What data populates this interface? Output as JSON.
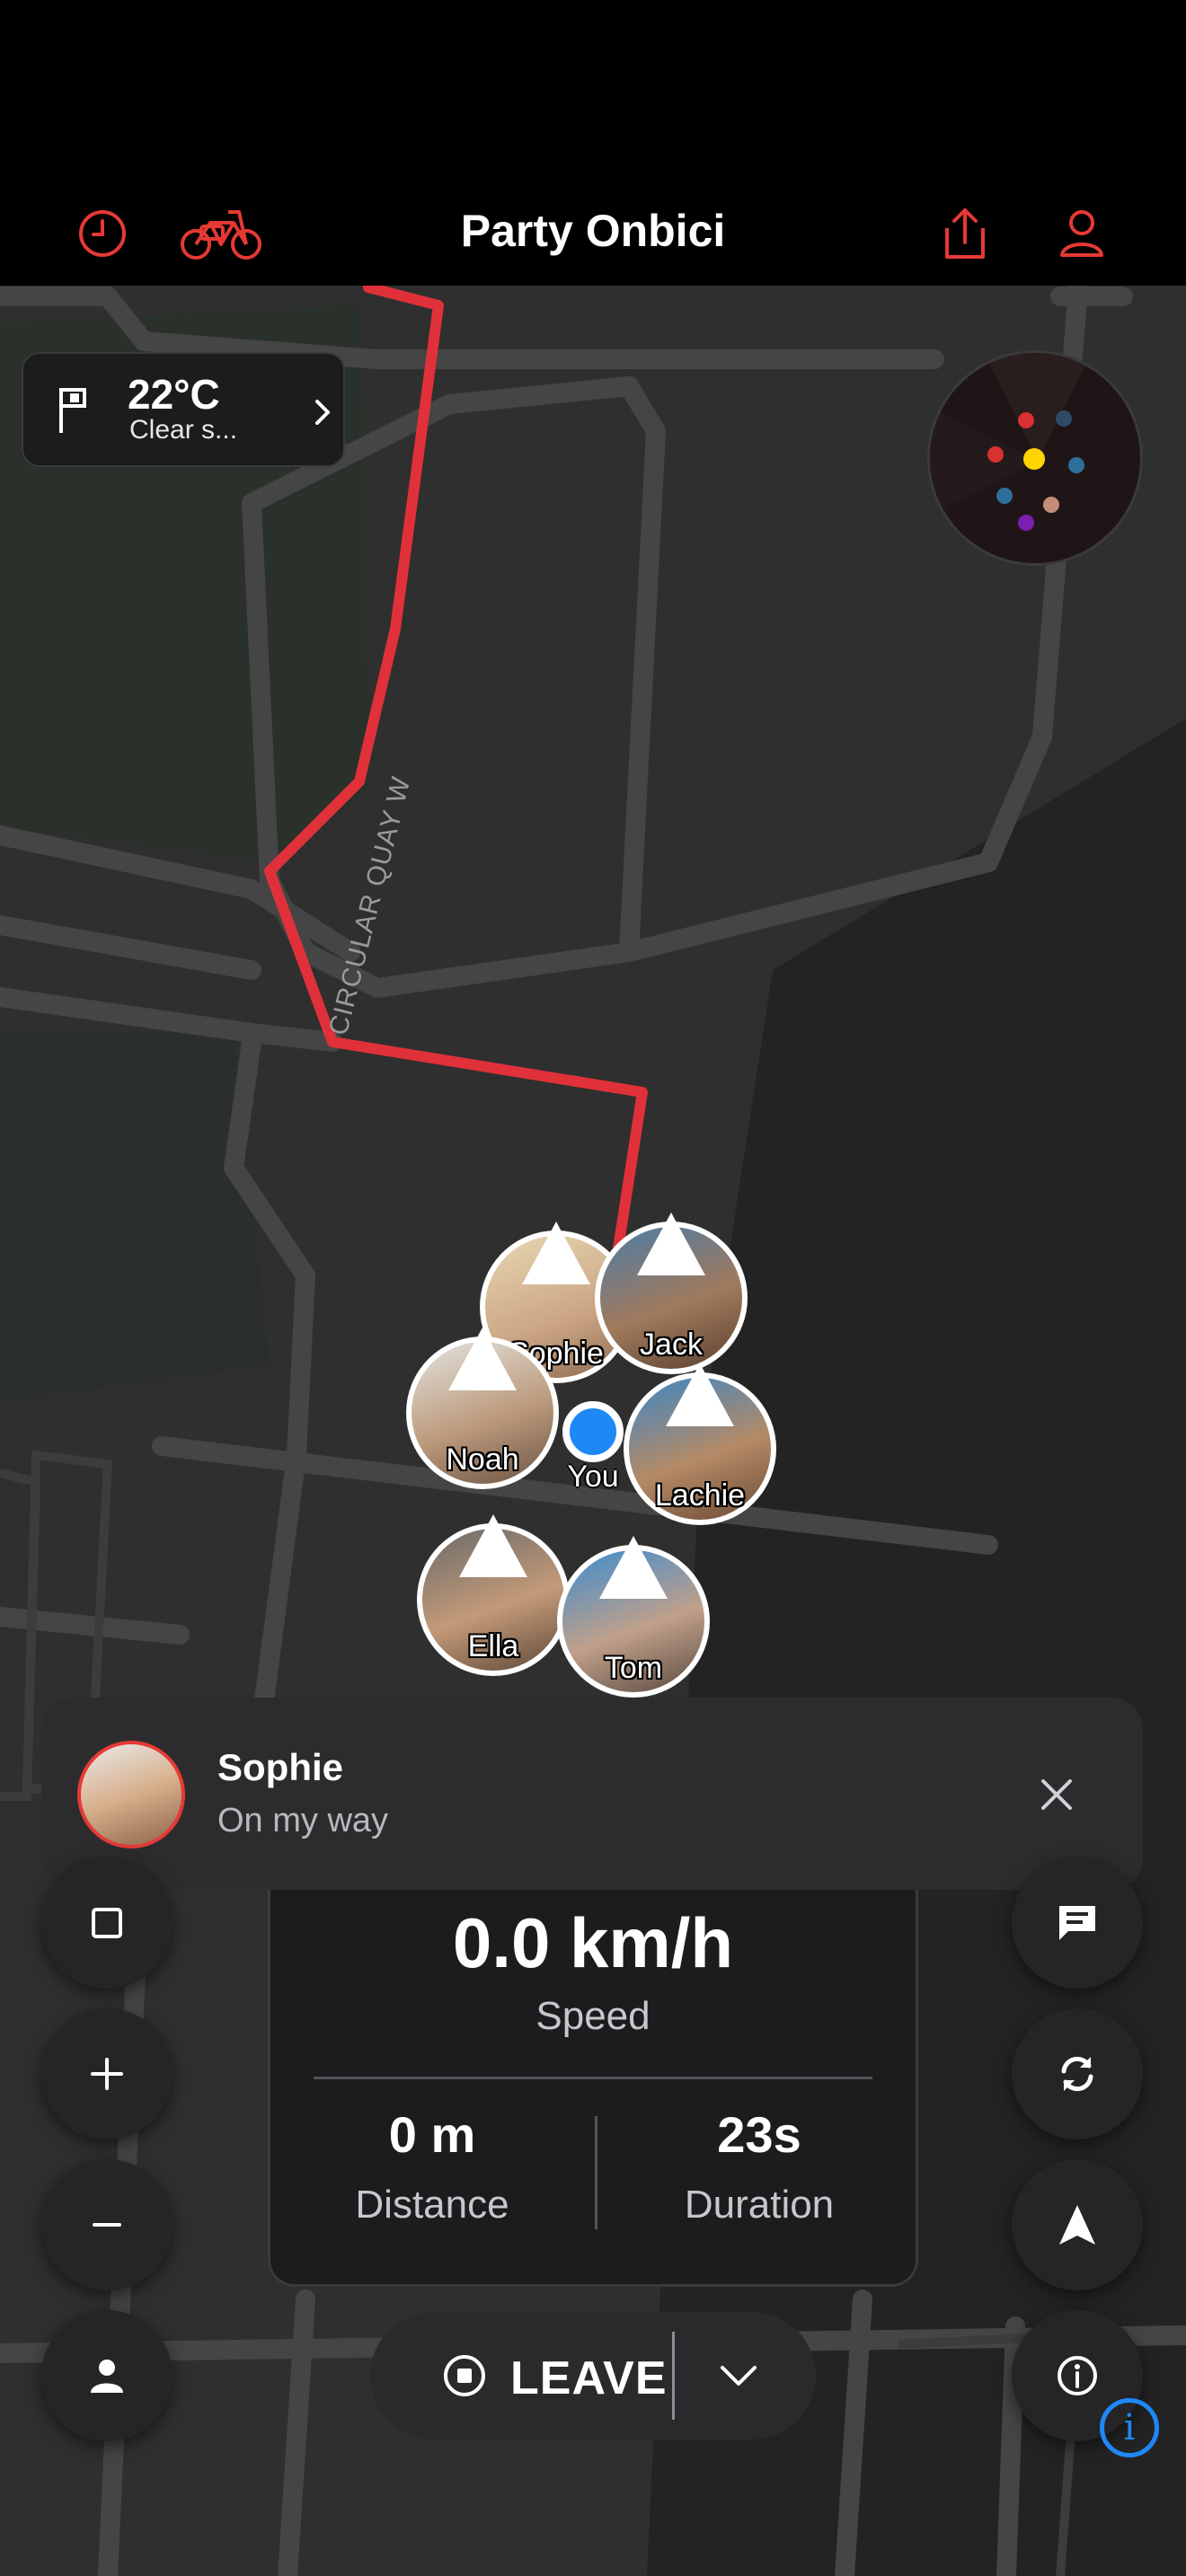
{
  "header": {
    "title": "Party Onbici"
  },
  "weather": {
    "temperature": "22°C",
    "condition": "Clear s..."
  },
  "map": {
    "street_label": "CIRCULAR QUAY W"
  },
  "riders": [
    {
      "name": "Sophie"
    },
    {
      "name": "Jack"
    },
    {
      "name": "Noah"
    },
    {
      "name": "Lachie"
    },
    {
      "name": "Ella"
    },
    {
      "name": "Tom"
    }
  ],
  "you": {
    "label": "You"
  },
  "notification": {
    "name": "Sophie",
    "message": "On my way"
  },
  "stats": {
    "speed_value": "0.0 km/h",
    "speed_label": "Speed",
    "distance_value": "0 m",
    "distance_label": "Distance",
    "duration_value": "23s",
    "duration_label": "Duration"
  },
  "leave": {
    "label": "LEAVE"
  },
  "colors": {
    "accent": "#e53935",
    "route": "#e0313a",
    "location": "#1e88f7"
  }
}
